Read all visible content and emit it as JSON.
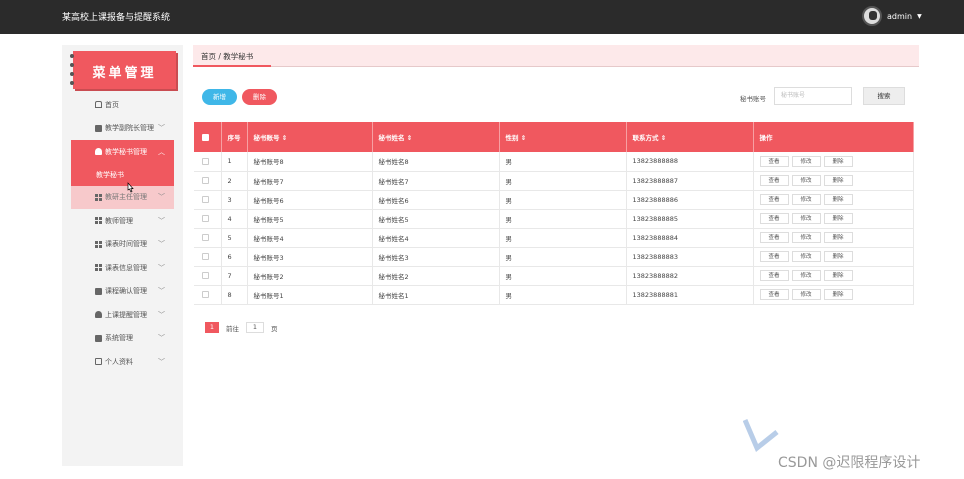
{
  "app": {
    "title": "某高校上课报备与提醒系统",
    "user": "admin"
  },
  "sidebar": {
    "logo_text": "菜单管理",
    "items": [
      {
        "label": "首页"
      },
      {
        "label": "教学副院长管理"
      },
      {
        "label": "教学秘书管理"
      },
      {
        "label": "教研主任管理"
      },
      {
        "label": "教师管理"
      },
      {
        "label": "课表时间管理"
      },
      {
        "label": "课表信息管理"
      },
      {
        "label": "课程确认管理"
      },
      {
        "label": "上课提醒管理"
      },
      {
        "label": "系统管理"
      },
      {
        "label": "个人资料"
      }
    ],
    "submenu": "教学秘书"
  },
  "breadcrumb": "首页 / 教学秘书",
  "toolbar": {
    "add": "新增",
    "delete": "删除",
    "search_label": "秘书账号",
    "search_placeholder": "秘书账号",
    "search": "搜索"
  },
  "table": {
    "headers": [
      "序号",
      "秘书账号 ⇕",
      "秘书姓名 ⇕",
      "性别 ⇕",
      "联系方式 ⇕",
      "操作"
    ],
    "rows": [
      [
        "1",
        "秘书账号8",
        "秘书姓名8",
        "男",
        "13823888888"
      ],
      [
        "2",
        "秘书账号7",
        "秘书姓名7",
        "男",
        "13823888887"
      ],
      [
        "3",
        "秘书账号6",
        "秘书姓名6",
        "男",
        "13823888886"
      ],
      [
        "4",
        "秘书账号5",
        "秘书姓名5",
        "男",
        "13823888885"
      ],
      [
        "5",
        "秘书账号4",
        "秘书姓名4",
        "男",
        "13823888884"
      ],
      [
        "6",
        "秘书账号3",
        "秘书姓名3",
        "男",
        "13823888883"
      ],
      [
        "7",
        "秘书账号2",
        "秘书姓名2",
        "男",
        "13823888882"
      ],
      [
        "8",
        "秘书账号1",
        "秘书姓名1",
        "男",
        "13823888881"
      ]
    ],
    "ops": [
      "查看",
      "修改",
      "删除"
    ]
  },
  "pager": {
    "page": "1",
    "goto_label": "前往",
    "goto_value": "1",
    "page_unit": "页"
  },
  "watermark": "CSDN @迟限程序设计",
  "colors": {
    "accent": "#f0585f",
    "add_button": "#3fb7e8",
    "topbar": "#2b2b2b"
  }
}
